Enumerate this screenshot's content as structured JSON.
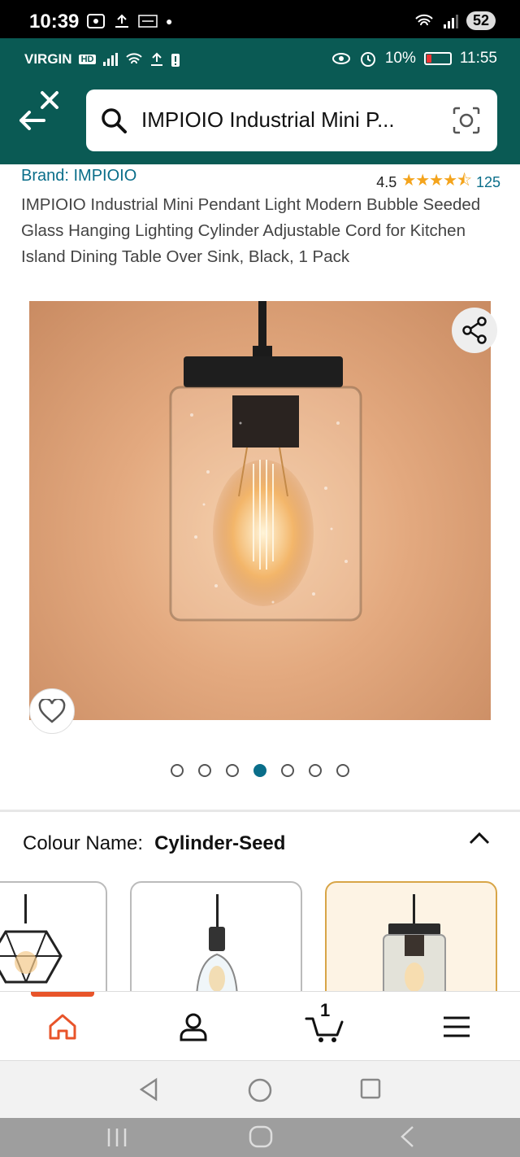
{
  "outer_status": {
    "time": "10:39",
    "battery": "52"
  },
  "inner_status": {
    "carrier": "VIRGIN",
    "hd": "HD",
    "battery_pct": "10%",
    "time": "11:55"
  },
  "search": {
    "query": "IMPIOIO Industrial Mini P..."
  },
  "product": {
    "brand": "Brand: IMPIOIO",
    "rating_value": "4.5",
    "rating_stars": 4.5,
    "review_count": "125",
    "title": "IMPIOIO Industrial Mini Pendant Light Modern Bubble Seeded Glass Hanging Lighting Cylinder Adjustable Cord for Kitchen Island Dining Table Over Sink, Black, 1 Pack"
  },
  "gallery": {
    "total_images": 7,
    "active_index": 3
  },
  "colour": {
    "label": "Colour Name:",
    "value": "Cylinder-Seed"
  },
  "variants": [
    {
      "name": "cage"
    },
    {
      "name": "clear-glass"
    },
    {
      "name": "cylinder-seed",
      "selected": true
    }
  ],
  "bottom_nav": {
    "cart_count": "1"
  },
  "colors": {
    "brand_teal": "#0a5a54",
    "link_blue": "#0a6e8a",
    "star_orange": "#f4a41c",
    "home_orange": "#e8542a"
  }
}
